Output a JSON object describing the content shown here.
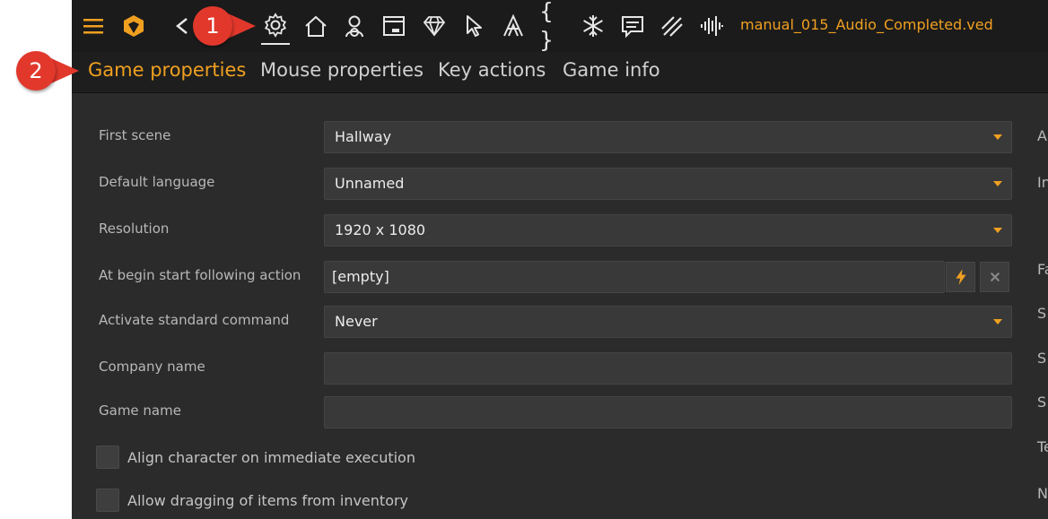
{
  "window": {
    "filename": "manual_015_Audio_Completed.ved"
  },
  "toolbar": {
    "icons": [
      "menu-icon",
      "logo-icon",
      "back-icon",
      "settings-icon",
      "home-icon",
      "character-icon",
      "background-icon",
      "diamond-icon",
      "cursor-icon",
      "font-icon",
      "script-icon",
      "snowflake-icon",
      "text-icon",
      "hatch-icon",
      "audio-icon"
    ],
    "braces_glyph": "{ }",
    "colors": {
      "accent": "#f0a020",
      "icon": "#e6e6e6",
      "background": "#1b1b1b"
    }
  },
  "tabs": [
    {
      "label": "Game properties",
      "active": true
    },
    {
      "label": "Mouse properties",
      "active": false
    },
    {
      "label": "Key actions",
      "active": false
    },
    {
      "label": "Game info",
      "active": false
    }
  ],
  "form": {
    "first_scene": {
      "label": "First scene",
      "value": "Hallway"
    },
    "default_language": {
      "label": "Default language",
      "value": "Unnamed"
    },
    "resolution": {
      "label": "Resolution",
      "value": "1920 x 1080"
    },
    "begin_action": {
      "label": "At begin start following action",
      "value": "[empty]"
    },
    "standard_command": {
      "label": "Activate standard command",
      "value": "Never"
    },
    "company_name": {
      "label": "Company name",
      "value": ""
    },
    "game_name": {
      "label": "Game name",
      "value": ""
    },
    "align_character": {
      "label": "Align character on immediate execution",
      "checked": false
    },
    "allow_dragging": {
      "label": "Allow dragging of items from inventory",
      "checked": false
    }
  },
  "right_column_cut": [
    "A",
    "In",
    "Fa",
    "S",
    "S",
    "S",
    "Te",
    "N"
  ],
  "callouts": [
    "1",
    "2"
  ]
}
